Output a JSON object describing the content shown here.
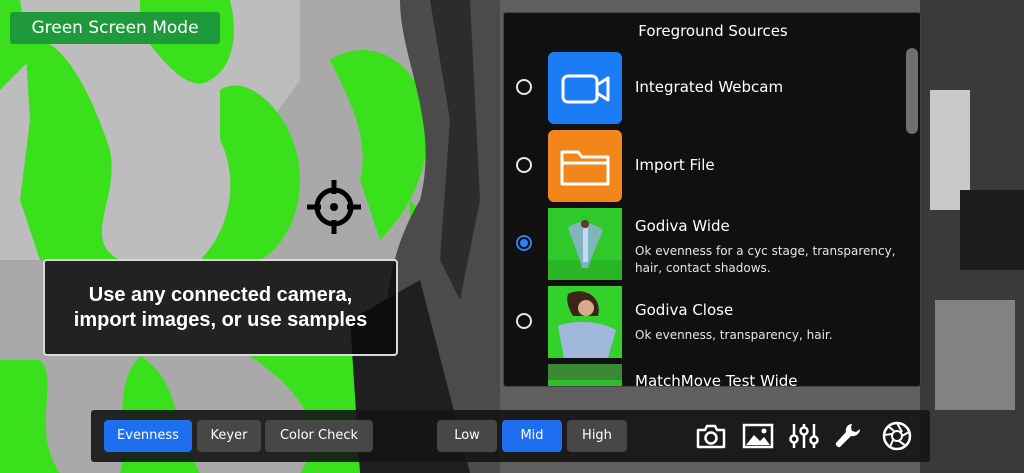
{
  "mode_badge": "Green Screen Mode",
  "info_card": {
    "line1": "Use any connected camera,",
    "line2": "import images, or use samples"
  },
  "panel": {
    "title": "Foreground Sources",
    "items": [
      {
        "title": "Integrated Webcam",
        "desc": "",
        "selected": false,
        "icon": "video-camera-icon"
      },
      {
        "title": "Import File",
        "desc": "",
        "selected": false,
        "icon": "folder-icon"
      },
      {
        "title": "Godiva Wide",
        "desc": "Ok evenness for a cyc stage, transparency, hair, contact shadows.",
        "selected": true,
        "icon": ""
      },
      {
        "title": "Godiva Close",
        "desc": "Ok evenness, transparency, hair.",
        "selected": false,
        "icon": ""
      },
      {
        "title": "MatchMove Test Wide",
        "desc": "",
        "selected": false,
        "icon": ""
      }
    ]
  },
  "toolbar": {
    "mode_tabs": [
      "Evenness",
      "Keyer",
      "Color Check"
    ],
    "active_mode": "Evenness",
    "levels": [
      "Low",
      "Mid",
      "High"
    ],
    "active_level": "Mid",
    "icons": [
      "camera-icon",
      "image-icon",
      "sliders-icon",
      "wrench-icon",
      "aperture-icon"
    ]
  },
  "colors": {
    "accent": "#1e6ff0",
    "badge": "#1f9a3b",
    "webcam_tile": "#1b7cf5",
    "file_tile": "#f3861a",
    "screen_green": "#3be01c"
  }
}
